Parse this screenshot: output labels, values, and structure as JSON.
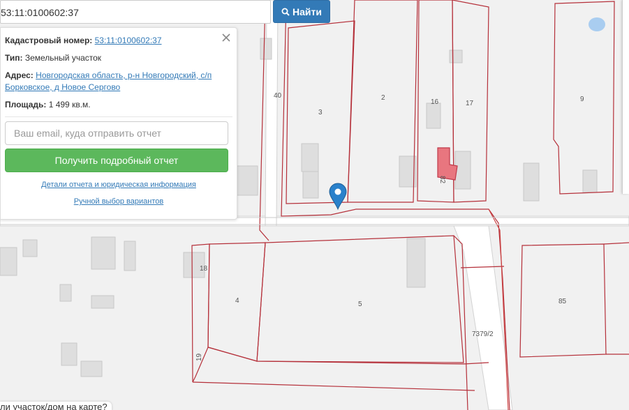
{
  "search": {
    "value": "53:11:0100602:37",
    "button_label": "Найти",
    "icon": "search-icon"
  },
  "panel": {
    "cadastral_label": "Кадастровый номер:",
    "cadastral_value": "53:11:0100602:37",
    "type_label": "Тип:",
    "type_value": "Земельный участок",
    "address_label": "Адрес:",
    "address_line1": "Новгородская область, р-н Новгородский, с/п",
    "address_line2": "Борковское, д Новое Сергово",
    "area_label": "Площадь:",
    "area_value": "1 499 кв.м.",
    "email_placeholder": "Ваш email, куда отправить отчет",
    "report_button": "Получить подробный отчет",
    "details_link": "Детали отчета и юридическая информация",
    "manual_link": "Ручной выбор вариантов"
  },
  "bottom_hint": "ли участок/дом на карте?",
  "map": {
    "parcel_labels": [
      "40",
      "3",
      "2",
      "16",
      "17",
      "9",
      "82",
      "18",
      "4",
      "5",
      "85",
      "7379/2",
      "19"
    ],
    "colors": {
      "boundary": "#b5303a",
      "road": "#ffffff",
      "building": "#dedede",
      "highlight": "#e8767f",
      "water": "#a9cdf0",
      "marker": "#2a81cb"
    }
  }
}
